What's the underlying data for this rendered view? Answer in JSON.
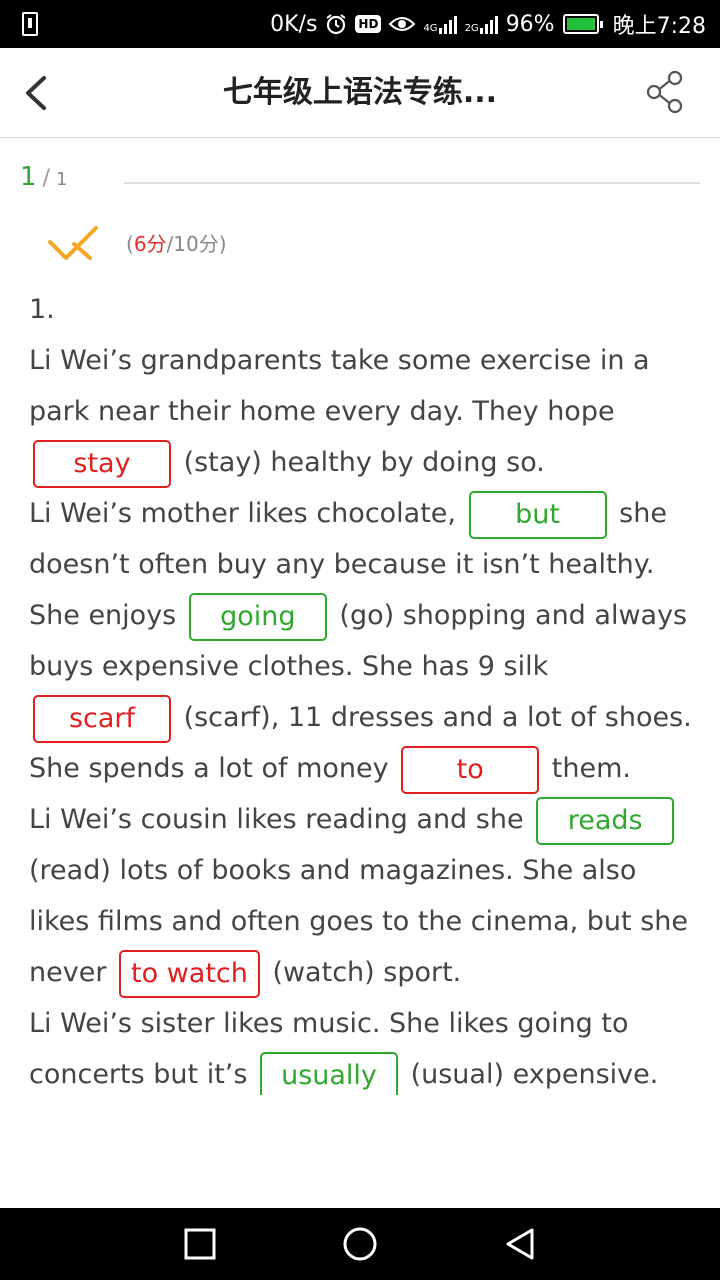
{
  "status_bar": {
    "speed": "0K/s",
    "hd": "HD",
    "net1": "4G",
    "net2": "2G",
    "battery": "96%",
    "time": "晚上7:28"
  },
  "header": {
    "title": "七年级上语法专练..."
  },
  "pager": {
    "current": "1",
    "separator": "/",
    "total": "1"
  },
  "score": {
    "open": "(",
    "got": "6分",
    "rest": "/10分)"
  },
  "question": {
    "number": "1.",
    "paragraphs": [
      [
        {
          "t": "Li Wei’s grandparents take some exercise in a park near their home every day. They hope "
        },
        {
          "blank": "stay",
          "correct": false
        },
        {
          "t": " (stay) healthy by doing so."
        }
      ],
      [
        {
          "t": "Li Wei’s mother likes chocolate, "
        },
        {
          "blank": "but",
          "correct": true
        },
        {
          "t": " she doesn’t often buy any because it isn’t healthy. She enjoys "
        },
        {
          "blank": "going",
          "correct": true
        },
        {
          "t": " (go) shopping and always buys expensive clothes. She has 9 silk "
        },
        {
          "blank": "scarf",
          "correct": false
        },
        {
          "t": " (scarf), 11 dresses and a lot of shoes. She spends a lot of money "
        },
        {
          "blank": "to",
          "correct": false
        },
        {
          "t": " them."
        }
      ],
      [
        {
          "t": "Li Wei’s cousin likes reading and she "
        },
        {
          "blank": "reads",
          "correct": true
        },
        {
          "t": " (read) lots of books and magazines. She also likes films and often goes to the cinema, but she never "
        },
        {
          "blank": "to watch",
          "correct": false
        },
        {
          "t": " (watch) sport."
        }
      ],
      [
        {
          "t": "Li Wei’s sister likes music. She likes going to concerts but it’s "
        },
        {
          "blank": "usually",
          "correct": true
        },
        {
          "t": " (usual) expensive. She"
        }
      ]
    ]
  },
  "colors": {
    "correct": "#2fa82f",
    "wrong": "#e02020",
    "check_icon": "#f5a623"
  },
  "icons": {
    "back": "chevron-left-icon",
    "share": "share-icon",
    "check": "check-mark-icon",
    "nav_recent": "square-icon",
    "nav_home": "circle-icon",
    "nav_back": "triangle-left-icon"
  }
}
